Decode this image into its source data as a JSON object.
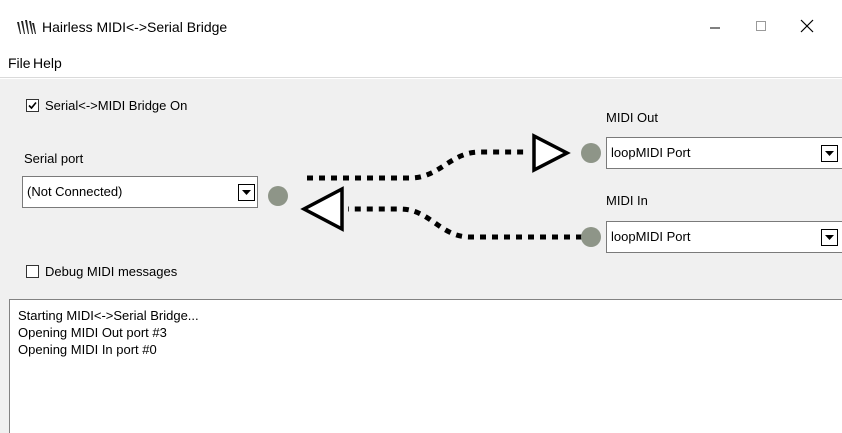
{
  "window": {
    "title": "Hairless MIDI<->Serial Bridge",
    "icon": "hairless-app-icon",
    "controls": {
      "minimize_icon": "minimize-icon",
      "maximize_icon": "maximize-icon",
      "close_icon": "close-icon"
    }
  },
  "menu": {
    "items": [
      "File",
      "Help"
    ]
  },
  "bridge": {
    "label": "Serial<->MIDI Bridge On",
    "checked": true
  },
  "serial": {
    "label": "Serial port",
    "value": "(Not Connected)"
  },
  "midi_out": {
    "label": "MIDI Out",
    "value": "loopMIDI Port"
  },
  "midi_in": {
    "label": "MIDI In",
    "value": "loopMIDI Port"
  },
  "debug": {
    "label": "Debug MIDI messages",
    "checked": false
  },
  "log": {
    "lines": [
      "Starting MIDI<->Serial Bridge...",
      "Opening MIDI Out port #3",
      "Opening MIDI In port #0"
    ]
  },
  "colors": {
    "led": "#8e9588",
    "client_bg": "#f0f0f0"
  }
}
